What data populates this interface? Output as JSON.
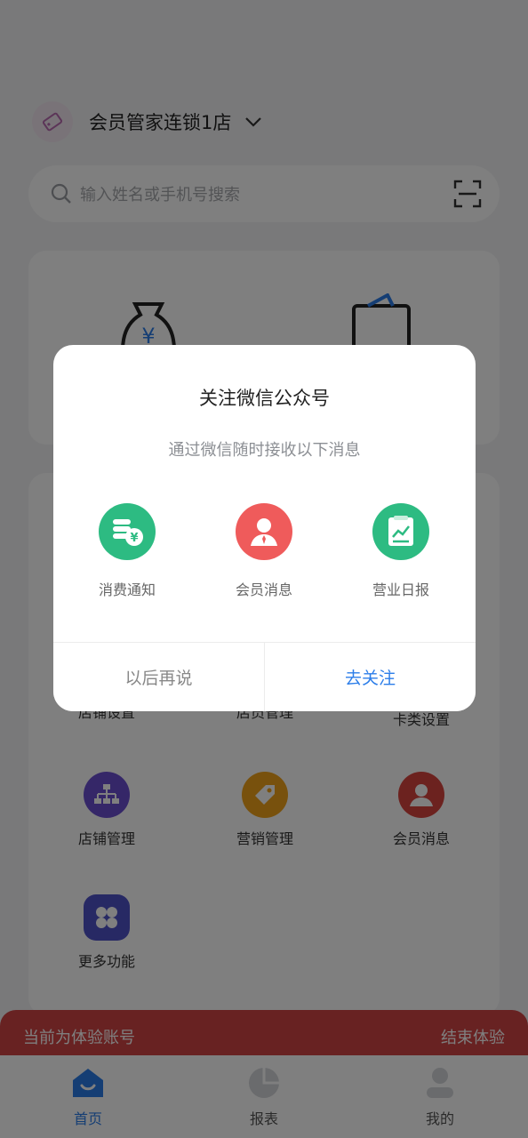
{
  "header": {
    "store_name": "会员管家连锁1店"
  },
  "search": {
    "placeholder": "输入姓名或手机号搜索"
  },
  "grid": {
    "items": [
      {
        "label": "店铺设置"
      },
      {
        "label": "店员管理"
      },
      {
        "label": "卡类设置"
      },
      {
        "label": "店铺管理"
      },
      {
        "label": "营销管理"
      },
      {
        "label": "会员消息"
      },
      {
        "label": "更多功能"
      }
    ]
  },
  "trial_banner": {
    "text": "当前为体验账号",
    "end_label": "结束体验"
  },
  "tabbar": {
    "tabs": [
      {
        "label": "首页"
      },
      {
        "label": "报表"
      },
      {
        "label": "我的"
      }
    ]
  },
  "dialog": {
    "title": "关注微信公众号",
    "subtitle": "通过微信随时接收以下消息",
    "features": [
      {
        "label": "消费通知"
      },
      {
        "label": "会员消息"
      },
      {
        "label": "营业日报"
      }
    ],
    "later_label": "以后再说",
    "follow_label": "去关注"
  },
  "colors": {
    "accent": "#2b7de9",
    "green": "#2dbb82",
    "red": "#ef5b5b",
    "banner": "#d04545",
    "purple": "#6a4fd1",
    "orange": "#f0a21a",
    "crimson": "#d9453f"
  }
}
